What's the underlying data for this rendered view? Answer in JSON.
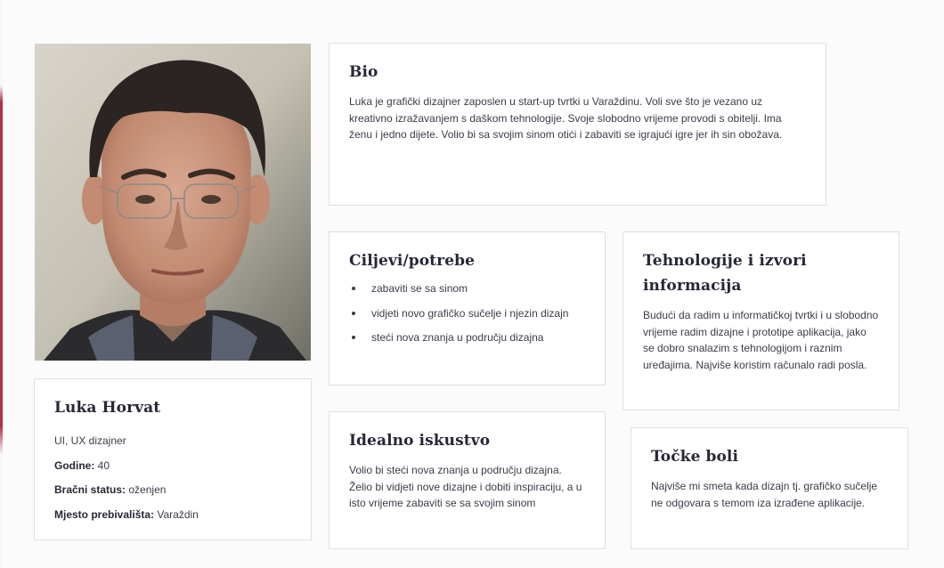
{
  "profile": {
    "name": "Luka Horvat",
    "role": "UI, UX dizajner",
    "age_label": "Godine:",
    "age_value": "40",
    "marital_label": "Bračni status:",
    "marital_value": "oženjen",
    "residence_label": "Mjesto prebivališta:",
    "residence_value": "Varaždin"
  },
  "bio": {
    "title": "Bio",
    "text": "Luka je grafički dizajner zaposlen u start-up tvrtki u Varaždinu. Voli sve što je vezano uz kreativno izražavanjem s daškom tehnologije. Svoje slobodno vrijeme provodi s obitelji. Ima ženu i jedno dijete. Volio bi sa svojim sinom otići i zabaviti se igrajući igre jer ih sin obožava."
  },
  "goals": {
    "title": "Ciljevi/potrebe",
    "items": [
      "zabaviti se sa sinom",
      "vidjeti novo grafičko sučelje i njezin dizajn",
      "steći nova znanja u području dizajna"
    ]
  },
  "tech": {
    "title": "Tehnologije i izvori informacija",
    "text": "Budući da radim u informatičkoj tvrtki i u slobodno vrijeme radim dizajne i prototipe aplikacija, jako se dobro snalazim s tehnologijom i raznim uređajima. Najviše koristim računalo radi posla."
  },
  "ideal": {
    "title": "Idealno iskustvo",
    "text": "Volio bi steći nova znanja u području dizajna. Želio bi vidjeti nove dizajne i dobiti inspiraciju, a u isto vrijeme zabaviti se sa svojim sinom"
  },
  "pain": {
    "title": "Točke boli",
    "text": "Najviše mi smeta kada dizajn tj. grafičko sučelje ne odgovara s temom iza izrađene aplikacije."
  }
}
